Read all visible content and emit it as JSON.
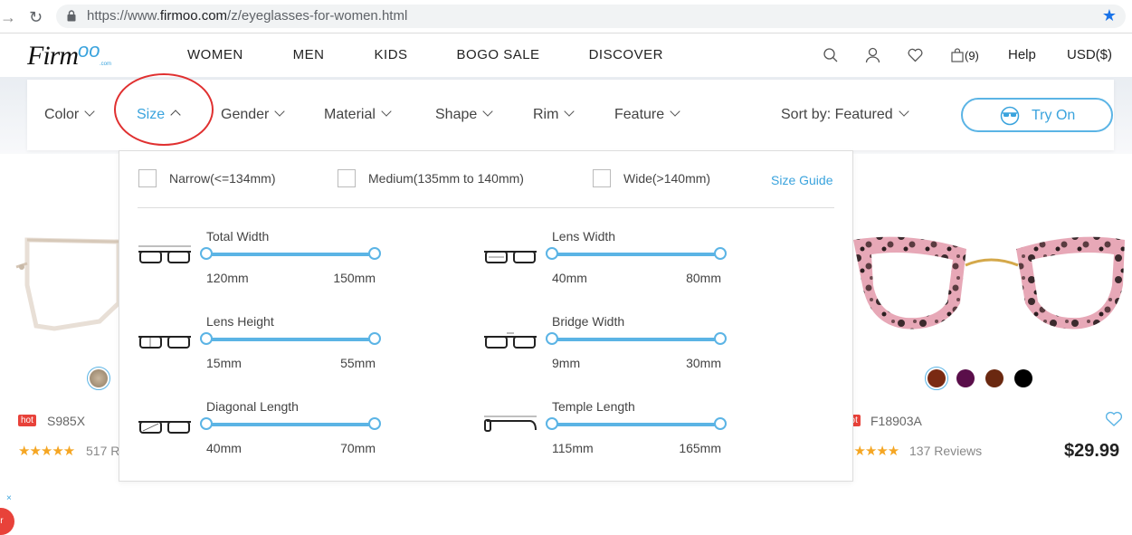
{
  "browser": {
    "url_prefix": "https://www.",
    "url_main": "firmoo.com",
    "url_path": "/z/eyeglasses-for-women.html"
  },
  "header": {
    "logo_firm": "Firm",
    "logo_oo": "oo",
    "logo_com": ".com",
    "nav": [
      "WOMEN",
      "MEN",
      "KIDS",
      "BOGO SALE",
      "DISCOVER"
    ],
    "cart_count": "(9)",
    "help": "Help",
    "currency": "USD($)"
  },
  "filters": {
    "color": "Color",
    "size": "Size",
    "gender": "Gender",
    "material": "Material",
    "shape": "Shape",
    "rim": "Rim",
    "feature": "Feature",
    "sort": "Sort by: Featured",
    "try_on": "Try On"
  },
  "size_panel": {
    "options": [
      "Narrow(<=134mm)",
      "Medium(135mm to 140mm)",
      "Wide(>140mm)"
    ],
    "size_guide": "Size Guide",
    "sliders": [
      {
        "title": "Total Width",
        "min": "120mm",
        "max": "150mm"
      },
      {
        "title": "Lens Width",
        "min": "40mm",
        "max": "80mm"
      },
      {
        "title": "Lens Height",
        "min": "15mm",
        "max": "55mm"
      },
      {
        "title": "Bridge Width",
        "min": "9mm",
        "max": "30mm"
      },
      {
        "title": "Diagonal Length",
        "min": "40mm",
        "max": "70mm"
      },
      {
        "title": "Temple Length",
        "min": "115mm",
        "max": "165mm"
      }
    ]
  },
  "products": {
    "left": {
      "hot": "hot",
      "code": "S985X",
      "reviews": "517 R"
    },
    "right": {
      "hot": "hot",
      "code": "F18903A",
      "reviews": "137 Reviews",
      "price": "$29.99"
    }
  },
  "misc": {
    "close": "×",
    "badge": "ir"
  },
  "colors": {
    "accent": "#3aa3dd",
    "annotation": "#e03030",
    "hot": "#e8423a",
    "stars": "#f5a623"
  }
}
